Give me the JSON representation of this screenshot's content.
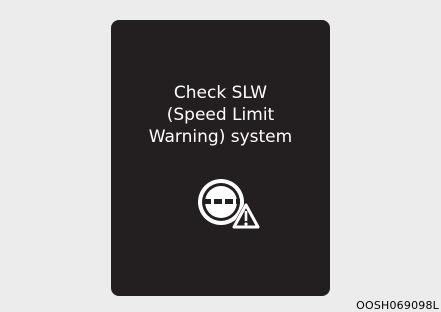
{
  "screen": {
    "message_lines": [
      "Check SLW",
      "(Speed Limit",
      "Warning) system"
    ],
    "icon": "speed-limit-warning-fault-icon"
  },
  "figure_code": "OOSH069098L",
  "colors": {
    "background": "#ececec",
    "panel": "#231f20",
    "text": "#ffffff",
    "warning_triangle": "#ffffff"
  }
}
